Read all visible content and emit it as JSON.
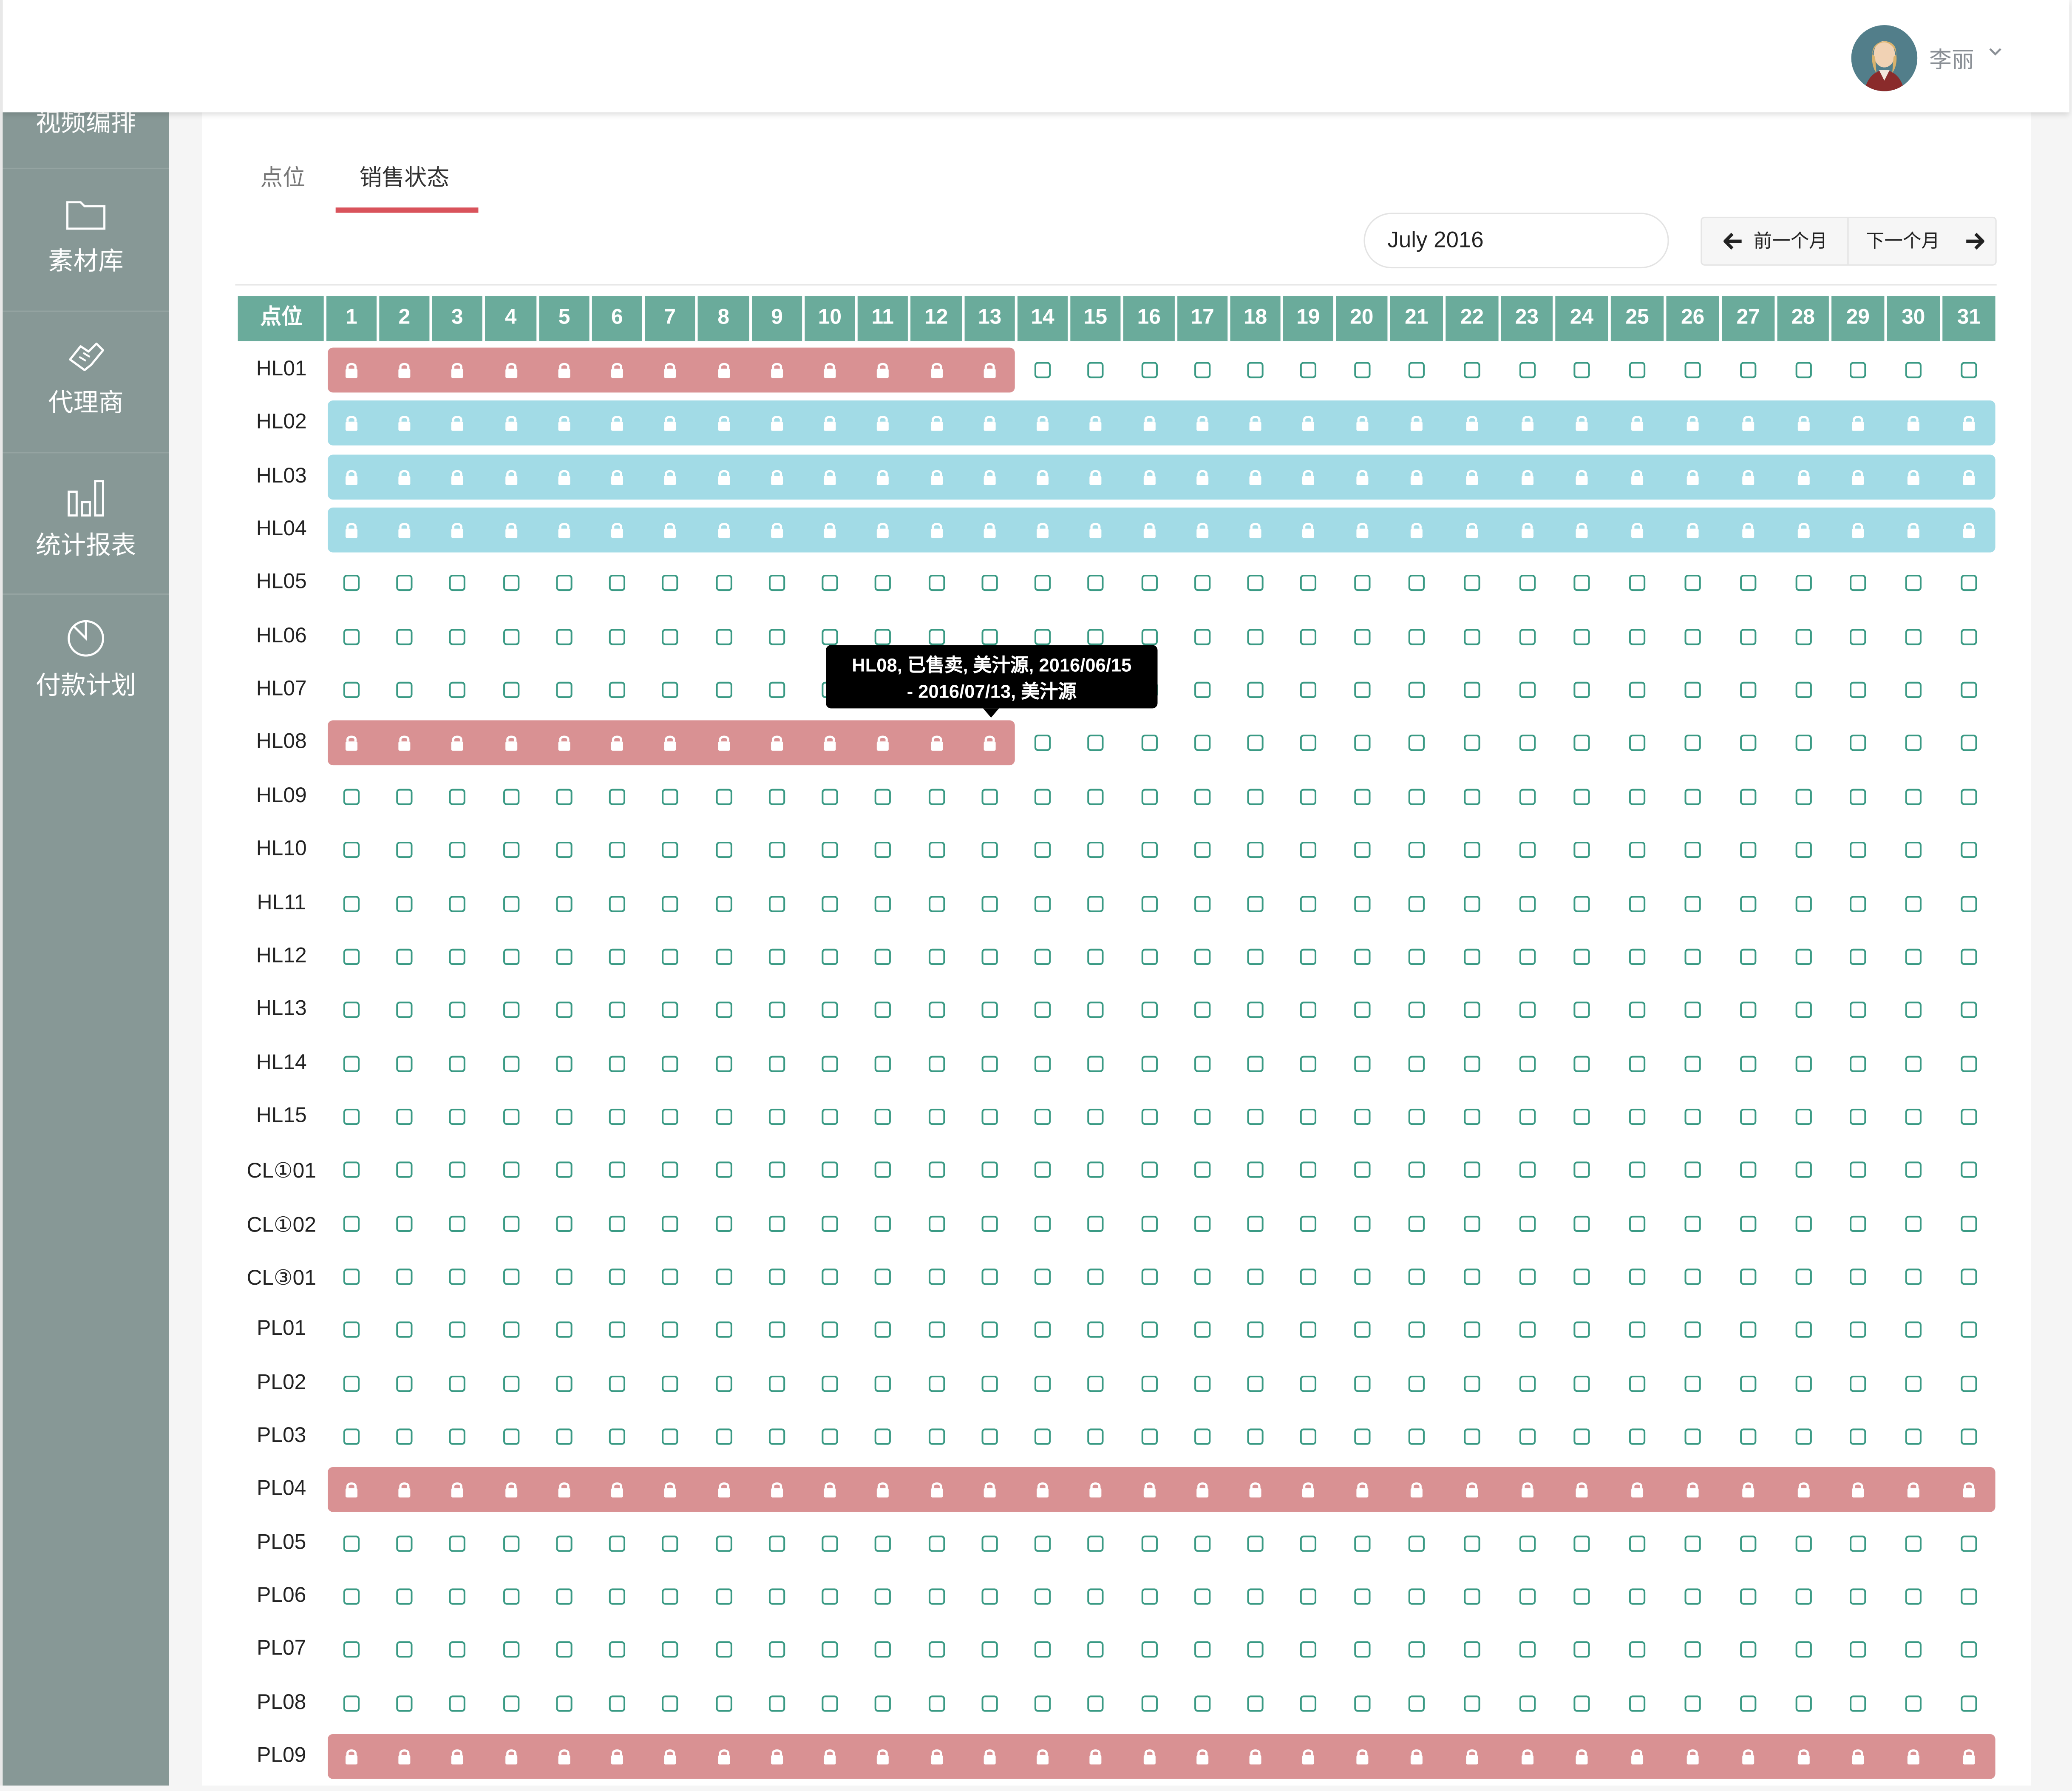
{
  "sidebar": {
    "partial_item": "视频编排",
    "items": [
      {
        "label": "素材库",
        "icon": "folder-icon"
      },
      {
        "label": "代理商",
        "icon": "handshake-icon"
      },
      {
        "label": "统计报表",
        "icon": "bar-chart-icon"
      },
      {
        "label": "付款计划",
        "icon": "pie-chart-icon"
      }
    ],
    "bg_color": "#879896"
  },
  "header": {
    "username": "李丽",
    "avatar": "user-avatar"
  },
  "tabs": [
    {
      "label": "点位",
      "active": false
    },
    {
      "label": "销售状态",
      "active": true
    }
  ],
  "calendar": {
    "month": "July 2016",
    "prev_label": "前一个月",
    "next_label": "下一个月"
  },
  "grid": {
    "corner_label": "点位",
    "header_color": "#6aab9b",
    "sold_color": "#d99193",
    "reserved_color": "#a2dbe6",
    "days": [
      "1",
      "2",
      "3",
      "4",
      "5",
      "6",
      "7",
      "8",
      "9",
      "10",
      "11",
      "12",
      "13",
      "14",
      "15",
      "16",
      "17",
      "18",
      "19",
      "20",
      "21",
      "22",
      "23",
      "24",
      "25",
      "26",
      "27",
      "28",
      "29",
      "30",
      "31"
    ],
    "rows": [
      {
        "label": "HL01",
        "status": "sold",
        "from_day": 1,
        "to_day": 13
      },
      {
        "label": "HL02",
        "status": "reserved",
        "from_day": 1,
        "to_day": 31
      },
      {
        "label": "HL03",
        "status": "reserved",
        "from_day": 1,
        "to_day": 31
      },
      {
        "label": "HL04",
        "status": "reserved",
        "from_day": 1,
        "to_day": 31
      },
      {
        "label": "HL05"
      },
      {
        "label": "HL06"
      },
      {
        "label": "HL07"
      },
      {
        "label": "HL08",
        "status": "sold",
        "from_day": 1,
        "to_day": 13
      },
      {
        "label": "HL09"
      },
      {
        "label": "HL10"
      },
      {
        "label": "HL11"
      },
      {
        "label": "HL12"
      },
      {
        "label": "HL13"
      },
      {
        "label": "HL14"
      },
      {
        "label": "HL15"
      },
      {
        "label": "CL①01"
      },
      {
        "label": "CL①02"
      },
      {
        "label": "CL③01"
      },
      {
        "label": "PL01"
      },
      {
        "label": "PL02"
      },
      {
        "label": "PL03"
      },
      {
        "label": "PL04",
        "status": "sold",
        "from_day": 1,
        "to_day": 31
      },
      {
        "label": "PL05"
      },
      {
        "label": "PL06"
      },
      {
        "label": "PL07"
      },
      {
        "label": "PL08"
      },
      {
        "label": "PL09",
        "status": "sold",
        "from_day": 1,
        "to_day": 31
      }
    ]
  },
  "tooltip": {
    "line1": "HL08, 已售卖, 美汁源, 2016/06/15",
    "line2": "- 2016/07/13, 美汁源"
  }
}
